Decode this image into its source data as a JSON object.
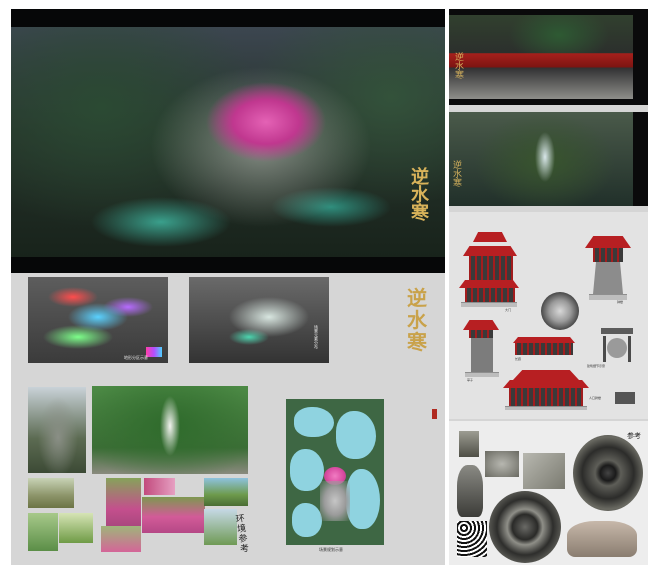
{
  "hero": {
    "calligraphy": "逆水寒"
  },
  "concept_board": {
    "calligraphy": "逆水寒",
    "map_a_caption": "地形分区示意",
    "map_b_caption": "场景元素分布",
    "reference_caption": "环境参考",
    "map_caption": "场景规划示意"
  },
  "right": {
    "temple_calligraphy": "逆水寒",
    "cave_calligraphy": "逆水寒",
    "arch_labels": {
      "main_hall": "大门",
      "tower": "钟楼",
      "pavilion": "亭子",
      "corridor": "长廊",
      "side_hall": "偏殿正面",
      "small_hall": "人口牌楼",
      "side_object": "建筑细节示意"
    },
    "reference_title": "参考"
  }
}
